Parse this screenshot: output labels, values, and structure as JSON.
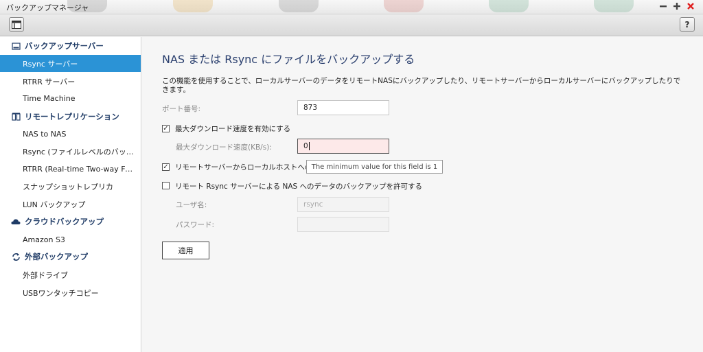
{
  "window": {
    "title": "バックアップマネージャ"
  },
  "toolbar": {
    "menu_icon": "panel-icon",
    "help_label": "?"
  },
  "sidebar": {
    "sections": [
      {
        "label": "バックアップサーバー",
        "icon": "server-icon"
      },
      {
        "label": "リモートレプリケーション",
        "icon": "replication-icon"
      },
      {
        "label": "クラウドバックアップ",
        "icon": "cloud-icon"
      },
      {
        "label": "外部バックアップ",
        "icon": "sync-icon"
      }
    ],
    "items": [
      {
        "label": "Rsync サーバー",
        "active": true
      },
      {
        "label": "RTRR サーバー"
      },
      {
        "label": "Time Machine"
      },
      {
        "label": "NAS to NAS"
      },
      {
        "label": "Rsync (ファイルレベルのバック..."
      },
      {
        "label": "RTRR (Real-time Two-way Folder ..."
      },
      {
        "label": "スナップショットレプリカ"
      },
      {
        "label": "LUN バックアップ"
      },
      {
        "label": "Amazon S3"
      },
      {
        "label": "外部ドライブ"
      },
      {
        "label": "USBワンタッチコピー"
      }
    ]
  },
  "main": {
    "heading": "NAS または Rsync にファイルをバックアップする",
    "description": "この機能を使用することで、ローカルサーバーのデータをリモートNASにバックアップしたり、リモートサーバーからローカルサーバーにバックアップしたりできます。",
    "port_label": "ポート番号:",
    "port_value": "873",
    "max_download_checkbox": {
      "label": "最大ダウンロード速度を有効にする",
      "checked": true
    },
    "max_download_label": "最大ダウンロード速度(KB/s):",
    "max_download_value": "0",
    "remote_to_local_checkbox": {
      "label": "リモートサーバーからローカルホストへの",
      "checked": true
    },
    "tooltip": "The minimum value for this field is 1",
    "allow_rsync_checkbox": {
      "label": "リモート Rsync サーバーによる NAS へのデータのバックアップを許可する",
      "checked": false
    },
    "username_label": "ユーザ名:",
    "username_value": "rsync",
    "password_label": "パスワード:",
    "password_value": "",
    "apply_label": "適用"
  },
  "colors": {
    "accent": "#2b93d6",
    "heading": "#2a3f6e",
    "section": "#1f3b66",
    "close": "#e02020"
  }
}
